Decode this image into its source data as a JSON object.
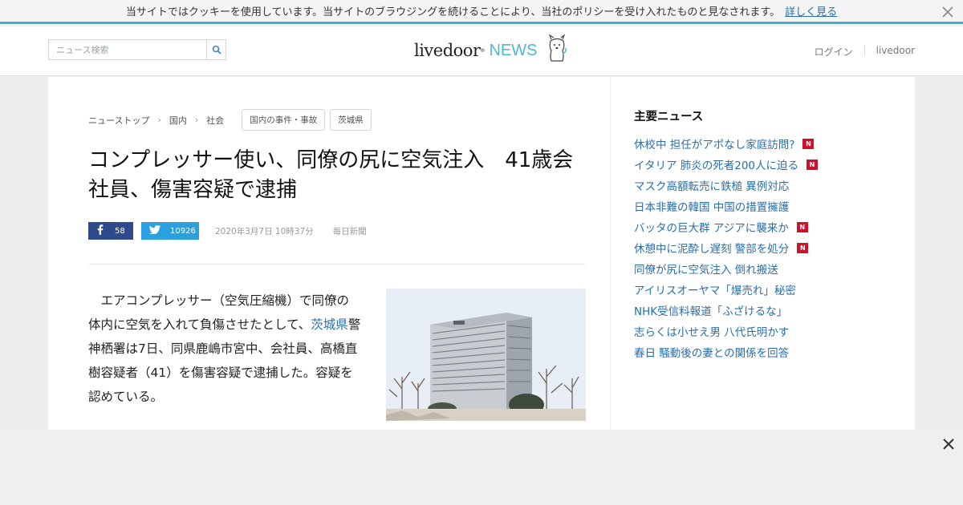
{
  "cookie_bar": {
    "message": "当サイトではクッキーを使用しています。当サイトのブラウジングを続けることにより、当社のポリシーを受け入れたものと見なされます。",
    "more_link": "詳しく見る",
    "close_icon": "close-icon"
  },
  "header": {
    "search": {
      "placeholder": "ニュース検索",
      "value": ""
    },
    "logo": {
      "text_livedoor": "livedoor",
      "text_news": "NEWS",
      "mascot": "dog-mascot-icon"
    },
    "links": {
      "login": "ログイン",
      "livedoor": "livedoor"
    },
    "accent_color": "#4db7d4"
  },
  "breadcrumb": {
    "items": [
      "ニューストップ",
      "国内",
      "社会"
    ],
    "tags": [
      "国内の事件・事故",
      "茨城県"
    ]
  },
  "article": {
    "title": "コンプレッサー使い、同僚の尻に空気注入　41歳会社員、傷害容疑で逮捕",
    "share": {
      "facebook_count": "58",
      "twitter_count": "10926",
      "facebook_color": "#2c4a8c",
      "twitter_color": "#2aa0de"
    },
    "datetime": "2020年3月7日 10時37分",
    "source": "毎日新聞",
    "body_before_link": "　エアコンプレッサー（空気圧縮機）で同僚の体内に空気を入れて負傷させたとして、",
    "body_link": "茨城県",
    "body_after_link": "警神栖署は7日、同県鹿嶋市宮中、会社員、高橋直樹容疑者（41）を傷害容疑で逮捕した。容疑を認めている。",
    "photo": "building-photo"
  },
  "sidebar": {
    "title": "主要ニュース",
    "new_badge": "N",
    "items": [
      {
        "label": "休校中 担任がアポなし家庭訪問?",
        "is_new": true
      },
      {
        "label": "イタリア 肺炎の死者200人に迫る",
        "is_new": true
      },
      {
        "label": "マスク高額転売に鉄槌 異例対応",
        "is_new": false
      },
      {
        "label": "日本非難の韓国 中国の措置擁護",
        "is_new": false
      },
      {
        "label": "バッタの巨大群 アジアに襲来か",
        "is_new": true
      },
      {
        "label": "休憩中に泥酔し遅刻 警部を処分",
        "is_new": true
      },
      {
        "label": "同僚が尻に空気注入 倒れ搬送",
        "is_new": false
      },
      {
        "label": "アイリスオーヤマ「爆売れ」秘密",
        "is_new": false
      },
      {
        "label": "NHK受信料報道「ふざけるな」",
        "is_new": false
      },
      {
        "label": "志らくは小せえ男 八代氏明かす",
        "is_new": false
      },
      {
        "label": "春日 騒動後の妻との関係を回答",
        "is_new": false
      }
    ]
  },
  "ad_bar": {
    "close_icon": "close-icon"
  }
}
